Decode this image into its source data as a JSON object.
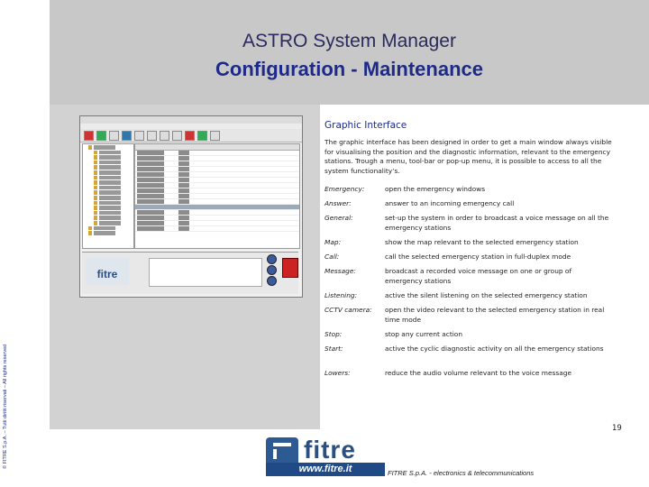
{
  "header": {
    "title": "ASTRO System Manager",
    "subtitle": "Configuration - Maintenance"
  },
  "copyright": "© FITRE S.p.A. – Tutti diritti riservati – All rights reserved",
  "section": {
    "title": "Graphic Interface",
    "intro": "The graphic interface has been designed in order to get a main window always visible for visualising the position and the diagnostic information, relevant to the emergency stations. Trough a menu, tool-bar or pop-up menu, it is possible to access to all the system functionality’s."
  },
  "definitions": [
    {
      "term": "Emergency:",
      "desc": "open the emergency windows"
    },
    {
      "term": "Answer:",
      "desc": "answer to an incoming emergency call"
    },
    {
      "term": "General:",
      "desc": "set-up the system in order to broadcast a voice message on all the emergency stations"
    },
    {
      "term": "Map:",
      "desc": "show the map relevant to the selected emergency station"
    },
    {
      "term": "Call:",
      "desc": "call the selected emergency station in full-duplex mode"
    },
    {
      "term": "Message:",
      "desc": "broadcast a recorded voice message on one or group of emergency stations"
    },
    {
      "term": "Listening:",
      "desc": "active the silent listening on the selected emergency station"
    },
    {
      "term": "CCTV camera:",
      "desc": "open the video relevant to the selected emergency station in real time mode"
    },
    {
      "term": "Stop:",
      "desc": "stop any current action"
    },
    {
      "term": "Start:",
      "desc": "active the cyclic diagnostic activity on all the emergency stations"
    },
    {
      "term": "Lowers:",
      "desc": "reduce the audio volume relevant to the voice message"
    }
  ],
  "footer": {
    "logo_text": "fitre",
    "url": "www.fitre.it",
    "company": "FITRE S.p.A. - electronics & telecommunications",
    "page_number": "19"
  },
  "screenshot": {
    "logo_text": "fitre"
  }
}
